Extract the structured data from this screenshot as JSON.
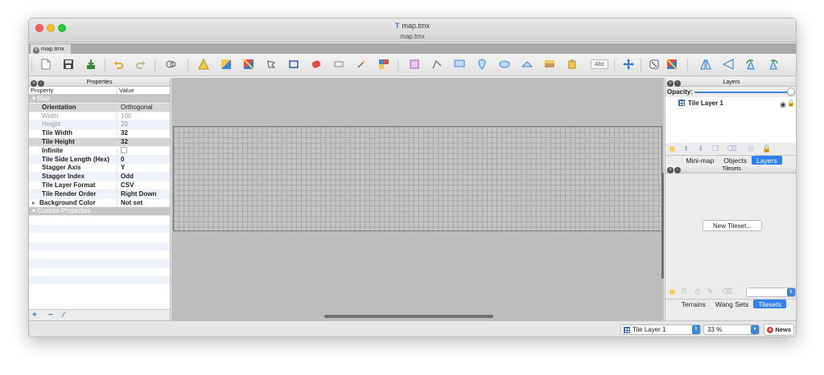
{
  "window": {
    "title": "map.tmx",
    "subtitle": "map.tmx"
  },
  "doc_tab": {
    "label": "map.tmx"
  },
  "toolbar": {
    "icons": [
      "new-icon",
      "save-icon",
      "export-icon",
      "undo-icon",
      "redo-icon",
      "stamp-brush-icon",
      "terrain-brush-icon",
      "wang-brush-icon",
      "bucket-fill-icon",
      "shape-fill-icon",
      "eraser-icon",
      "rectangle-select-icon",
      "magic-wand-icon",
      "select-same-tile-icon",
      "object-select-icon",
      "edit-polygons-icon",
      "insert-rectangle-icon",
      "insert-point-icon",
      "insert-ellipse-icon",
      "insert-polygon-icon",
      "insert-tile-icon",
      "insert-template-icon",
      "insert-text-icon",
      "offset-layer-icon",
      "random-mode-icon",
      "wang-fill-icon",
      "flip-horizontal-icon",
      "flip-vertical-icon",
      "rotate-left-icon",
      "rotate-right-icon"
    ],
    "text_tool_label": "Abc"
  },
  "properties": {
    "title": "Properties",
    "col_property": "Property",
    "col_value": "Value",
    "group_map": "Map",
    "rows": [
      {
        "name": "Orientation",
        "value": "Orthogonal"
      },
      {
        "name": "Width",
        "value": "100"
      },
      {
        "name": "Height",
        "value": "20"
      },
      {
        "name": "Tile Width",
        "value": "32"
      },
      {
        "name": "Tile Height",
        "value": "32"
      },
      {
        "name": "Infinite",
        "value": ""
      },
      {
        "name": "Tile Side Length (Hex)",
        "value": "0"
      },
      {
        "name": "Stagger Axis",
        "value": "Y"
      },
      {
        "name": "Stagger Index",
        "value": "Odd"
      },
      {
        "name": "Tile Layer Format",
        "value": "CSV"
      },
      {
        "name": "Tile Render Order",
        "value": "Right Down"
      },
      {
        "name": "Background Color",
        "value": "Not set"
      }
    ],
    "group_custom": "Custom Properties"
  },
  "layers": {
    "title": "Layers",
    "opacity_label": "Opacity:",
    "opacity": 1.0,
    "items": [
      {
        "name": "Tile Layer 1"
      }
    ],
    "tabs": [
      "Mini-map",
      "Objects",
      "Layers"
    ],
    "active_tab": "Layers"
  },
  "tilesets": {
    "title": "Tilesets",
    "new_button": "New Tileset...",
    "tabs": [
      "Terrains",
      "Wang Sets",
      "Tilesets"
    ],
    "active_tab": "Tilesets"
  },
  "status": {
    "layer_select": "Tile Layer 1",
    "zoom": "33 %",
    "news_label": "News"
  },
  "colors": {
    "accent": "#2f7ff5",
    "grid": "#a6a6a6",
    "canvas_bg": "#bdbdbd"
  }
}
